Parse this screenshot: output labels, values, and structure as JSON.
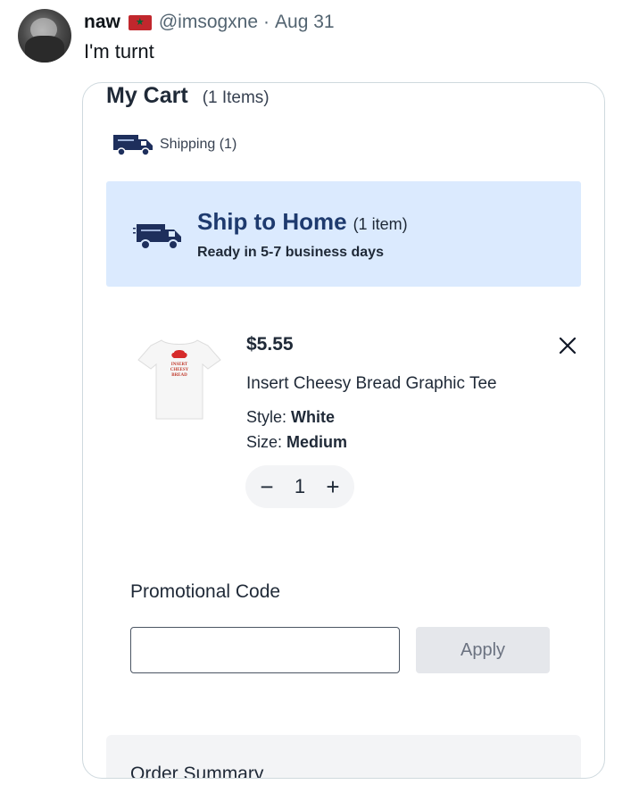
{
  "tweet": {
    "name": "naw",
    "handle": "@imsogxne",
    "separator": "·",
    "date": "Aug 31",
    "text": "I'm turnt"
  },
  "cart": {
    "title": "My Cart",
    "count": "(1 Items)",
    "shipping_tab": "Shipping (1)",
    "banner": {
      "title": "Ship to Home",
      "count": "(1 item)",
      "subtitle": "Ready in 5-7 business days"
    },
    "item": {
      "price": "$5.55",
      "name": "Insert Cheesy Bread Graphic Tee",
      "style_label": "Style: ",
      "style_value": "White",
      "size_label": "Size: ",
      "size_value": "Medium",
      "quantity": "1",
      "minus": "−",
      "plus": "+",
      "shirt_print": [
        "INSERT",
        "CHEESY",
        "BREAD"
      ]
    },
    "promo": {
      "label": "Promotional Code",
      "input_value": "",
      "placeholder": "",
      "apply_label": "Apply"
    },
    "summary_title": "Order Summary"
  },
  "colors": {
    "banner_bg": "#dbeafe",
    "banner_title": "#1e3a6e",
    "truck": "#1e2f5c",
    "flag_red": "#c1272d"
  },
  "icons": {
    "shipping": "truck-icon",
    "remove": "close-icon"
  }
}
